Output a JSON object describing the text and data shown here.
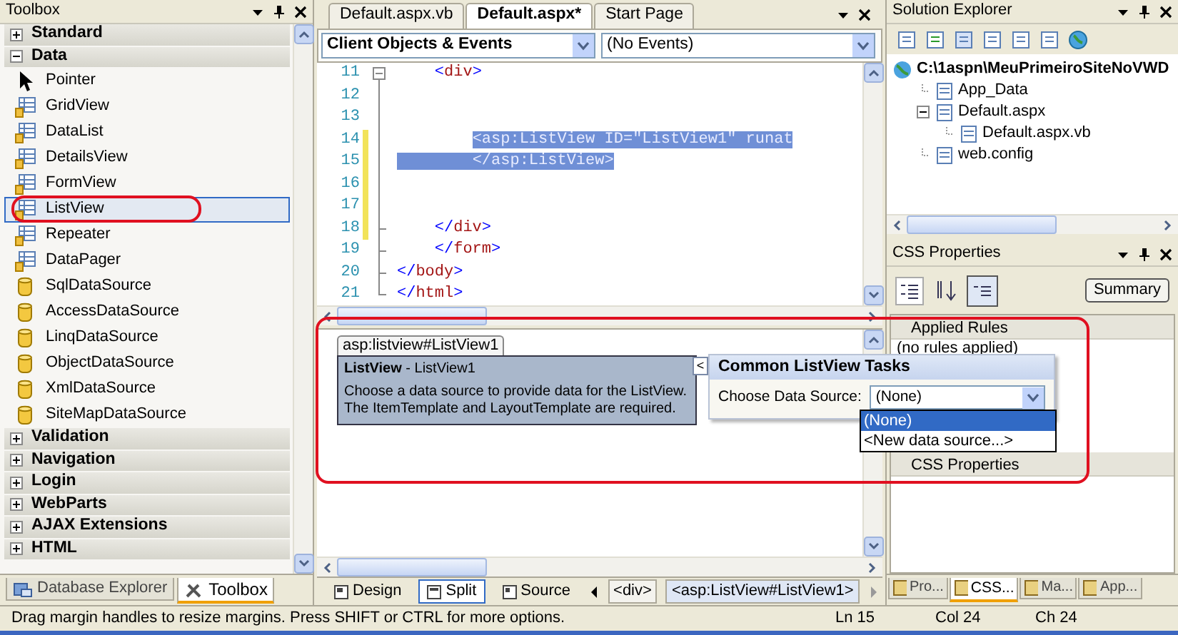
{
  "toolbox": {
    "title": "Toolbox",
    "categories": [
      {
        "label": "Standard",
        "expanded": false
      },
      {
        "label": "Data",
        "expanded": true,
        "items": [
          {
            "label": "Pointer",
            "selected": false
          },
          {
            "label": "GridView",
            "selected": false
          },
          {
            "label": "DataList",
            "selected": false
          },
          {
            "label": "DetailsView",
            "selected": false
          },
          {
            "label": "FormView",
            "selected": false
          },
          {
            "label": "ListView",
            "selected": true
          },
          {
            "label": "Repeater",
            "selected": false
          },
          {
            "label": "DataPager",
            "selected": false
          },
          {
            "label": "SqlDataSource",
            "selected": false
          },
          {
            "label": "AccessDataSource",
            "selected": false
          },
          {
            "label": "LinqDataSource",
            "selected": false
          },
          {
            "label": "ObjectDataSource",
            "selected": false
          },
          {
            "label": "XmlDataSource",
            "selected": false
          },
          {
            "label": "SiteMapDataSource",
            "selected": false
          }
        ]
      },
      {
        "label": "Validation",
        "expanded": false
      },
      {
        "label": "Navigation",
        "expanded": false
      },
      {
        "label": "Login",
        "expanded": false
      },
      {
        "label": "WebParts",
        "expanded": false
      },
      {
        "label": "AJAX Extensions",
        "expanded": false
      },
      {
        "label": "HTML",
        "expanded": false
      }
    ],
    "tabs": [
      {
        "label": "Database Explorer",
        "selected": false
      },
      {
        "label": "Toolbox",
        "selected": true
      }
    ]
  },
  "editor": {
    "tabs": [
      {
        "label": "Default.aspx.vb",
        "selected": false
      },
      {
        "label": "Default.aspx*",
        "selected": true
      },
      {
        "label": "Start Page",
        "selected": false
      }
    ],
    "object_dropdown": "Client Objects & Events",
    "event_dropdown": "(No Events)",
    "code_lines": [
      {
        "number": "11",
        "text": "    <div>",
        "selected": false,
        "changed": false
      },
      {
        "number": "12",
        "selected": false,
        "changed": false
      },
      {
        "number": "13",
        "selected": false,
        "changed": false
      },
      {
        "number": "14",
        "text": "        <asp:ListView ID=\"ListView1\" runat",
        "selected": true,
        "changed": true
      },
      {
        "number": "15",
        "text": "        </asp:ListView>",
        "selected": true,
        "changed": true
      },
      {
        "number": "16",
        "selected": false,
        "changed": true
      },
      {
        "number": "17",
        "selected": false,
        "changed": true
      },
      {
        "number": "18",
        "text": "    </div>",
        "selected": false,
        "changed": true
      },
      {
        "number": "19",
        "text": "    </form>",
        "selected": false,
        "changed": false
      },
      {
        "number": "20",
        "text": "</body>",
        "selected": false,
        "changed": false
      },
      {
        "number": "21",
        "text": "</html>",
        "selected": false,
        "changed": false
      }
    ],
    "design": {
      "tag_label": "asp:listview#ListView1",
      "control_title": "ListView",
      "control_id": "- ListView1",
      "message_lines": [
        "Choose a data source to provide data for the ListView.",
        "The ItemTemplate and LayoutTemplate are required."
      ],
      "smart_tag": {
        "toggle": "<",
        "title": "Common ListView Tasks",
        "field_label": "Choose Data Source:",
        "value": "(None)",
        "options": [
          {
            "label": "(None)",
            "selected": true
          },
          {
            "label": "<New data source...>",
            "selected": false
          }
        ]
      }
    },
    "view_tabs": [
      {
        "label": "Design",
        "selected": false
      },
      {
        "label": "Split",
        "selected": true
      },
      {
        "label": "Source",
        "selected": false
      }
    ],
    "breadcrumbs": [
      {
        "label": "<div>",
        "selected": false
      },
      {
        "label": "<asp:ListView#ListView1>",
        "selected": true
      }
    ]
  },
  "solution_explorer": {
    "title": "Solution Explorer",
    "tree": [
      {
        "label": "C:\\1aspn\\MeuPrimeiroSiteNoVWD",
        "children": [
          {
            "label": "App_Data"
          },
          {
            "label": "Default.aspx",
            "expanded": true,
            "children": [
              {
                "label": "Default.aspx.vb"
              }
            ]
          },
          {
            "label": "web.config"
          }
        ]
      }
    ]
  },
  "css_properties": {
    "title": "CSS Properties",
    "summary_button": "Summary",
    "applied_rules_header": "Applied Rules",
    "applied_rules_text": "(no rules applied)",
    "properties_header": "CSS Properties",
    "tabs": [
      {
        "label": "Pro...",
        "selected": false
      },
      {
        "label": "CSS...",
        "selected": true
      },
      {
        "label": "Ma...",
        "selected": false
      },
      {
        "label": "App...",
        "selected": false
      }
    ]
  },
  "status_bar": {
    "message": "Drag margin handles to resize margins. Press SHIFT or CTRL for more options.",
    "line": "Ln 15",
    "column": "Col 24",
    "character": "Ch 24"
  }
}
